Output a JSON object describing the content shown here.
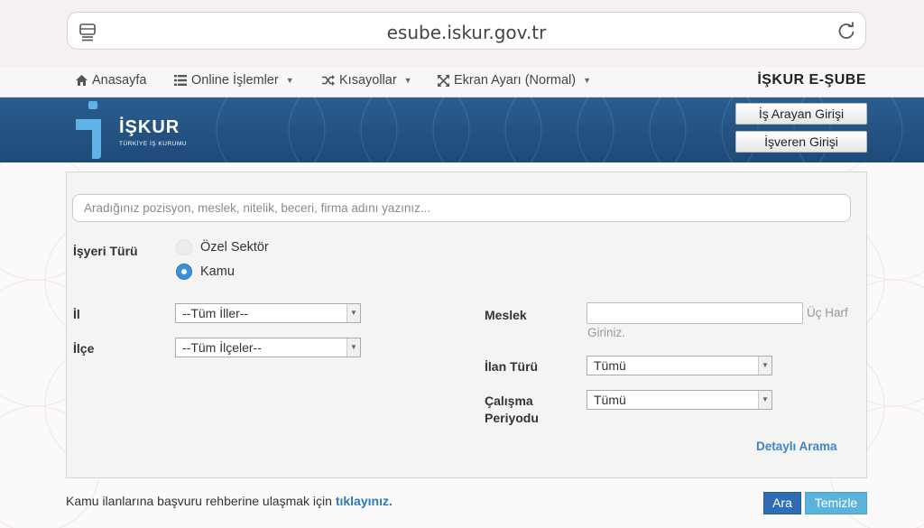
{
  "browser": {
    "url": "esube.iskur.gov.tr"
  },
  "nav": {
    "items": [
      {
        "label": "Anasayfa",
        "icon": "home-icon"
      },
      {
        "label": "Online İşlemler",
        "icon": "list-icon"
      },
      {
        "label": "Kısayollar",
        "icon": "shuffle-icon"
      },
      {
        "label": "Ekran Ayarı (Normal)",
        "icon": "expand-icon"
      }
    ],
    "brand": "İŞKUR E-ŞUBE"
  },
  "header": {
    "logo_text": "İŞKUR",
    "logo_subtext": "TÜRKİYE İŞ KURUMU",
    "job_seeker_login": "İş Arayan Girişi",
    "employer_login": "İşveren Girişi",
    "banner_color": "#1e4a78"
  },
  "search": {
    "placeholder": "Aradığınız pozisyon, meslek, nitelik, beceri, firma adını yazınız..."
  },
  "form": {
    "workplace_type_label": "İşyeri Türü",
    "workplace_options": [
      {
        "label": "Özel Sektör",
        "selected": false
      },
      {
        "label": "Kamu",
        "selected": true
      }
    ],
    "province_label": "İl",
    "province_value": "--Tüm İller--",
    "district_label": "İlçe",
    "district_value": "--Tüm İlçeler--",
    "profession_label": "Meslek",
    "profession_hint_1": "Üç Harf",
    "profession_hint_2": "Giriniz.",
    "listing_type_label": "İlan Türü",
    "listing_type_value": "Tümü",
    "work_period_label_1": "Çalışma",
    "work_period_label_2": "Periyodu",
    "work_period_value": "Tümü",
    "detailed_search": "Detaylı Arama"
  },
  "footer": {
    "text": "Kamu ilanlarına başvuru rehberine ulaşmak için",
    "link": "tıklayınız.",
    "search_button": "Ara",
    "clear_button": "Temizle",
    "accent_color": "#2f6db4"
  }
}
